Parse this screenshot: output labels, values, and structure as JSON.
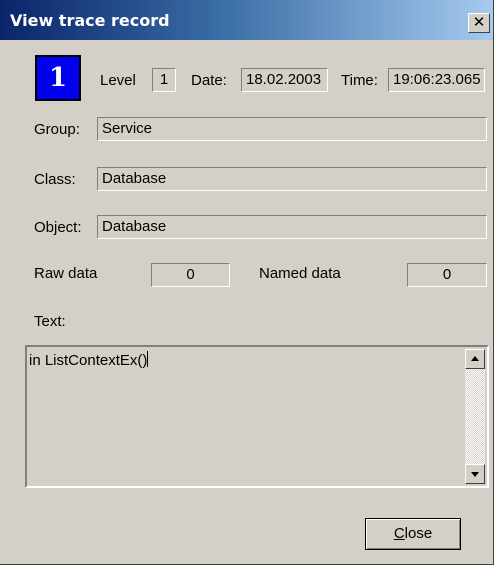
{
  "window": {
    "title": "View trace record",
    "close_glyph": "✕"
  },
  "level_badge": "1",
  "level": {
    "label": "Level",
    "value": "1"
  },
  "date": {
    "label": "Date:",
    "value": "18.02.2003"
  },
  "time": {
    "label": "Time:",
    "value": "19:06:23.065"
  },
  "group": {
    "label": "Group:",
    "value": "Service"
  },
  "class": {
    "label": "Class:",
    "value": "Database"
  },
  "object": {
    "label": "Object:",
    "value": "Database"
  },
  "raw_data": {
    "label": "Raw data",
    "value": "0"
  },
  "named_data": {
    "label": "Named data",
    "value": "0"
  },
  "text": {
    "label": "Text:",
    "value": "in ListContextEx()"
  },
  "close_button": {
    "accel": "C",
    "rest": "lose"
  },
  "colors": {
    "badge": "#0000ee",
    "titlebar_start": "#0a246a",
    "dialog_bg": "#d4d0c8"
  }
}
